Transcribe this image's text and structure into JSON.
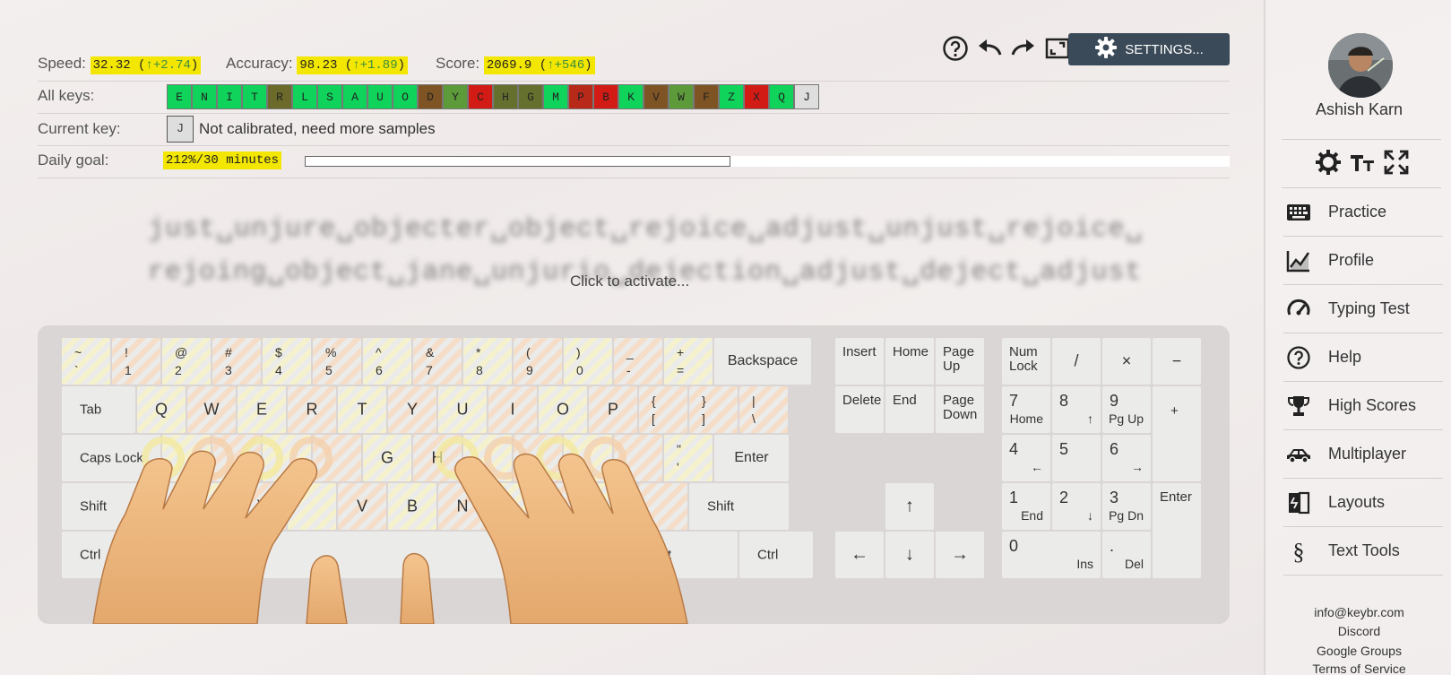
{
  "stats": {
    "speed_label": "Speed:",
    "speed_value": "32.32",
    "speed_delta": "↑+2.74",
    "accuracy_label": "Accuracy:",
    "accuracy_value": "98.23",
    "accuracy_delta": "↑+1.89",
    "score_label": "Score:",
    "score_value": "2069.9",
    "score_delta": "↑+546",
    "highlight_color": "#f3e600"
  },
  "all_keys": {
    "label": "All keys:",
    "keys": [
      {
        "k": "E",
        "color": "#0fd35a"
      },
      {
        "k": "N",
        "color": "#0fd35a"
      },
      {
        "k": "I",
        "color": "#0fd35a"
      },
      {
        "k": "T",
        "color": "#0fd35a"
      },
      {
        "k": "R",
        "color": "#6b6a2a"
      },
      {
        "k": "L",
        "color": "#0fd35a"
      },
      {
        "k": "S",
        "color": "#0fd35a"
      },
      {
        "k": "A",
        "color": "#0fd35a"
      },
      {
        "k": "U",
        "color": "#0fd35a"
      },
      {
        "k": "O",
        "color": "#0fd35a"
      },
      {
        "k": "D",
        "color": "#7f5424"
      },
      {
        "k": "Y",
        "color": "#5c9a3a"
      },
      {
        "k": "C",
        "color": "#d31b15"
      },
      {
        "k": "H",
        "color": "#66702e"
      },
      {
        "k": "G",
        "color": "#66702e"
      },
      {
        "k": "M",
        "color": "#0fd35a"
      },
      {
        "k": "P",
        "color": "#b8291a"
      },
      {
        "k": "B",
        "color": "#d31b15"
      },
      {
        "k": "K",
        "color": "#0fd35a"
      },
      {
        "k": "V",
        "color": "#7f5424"
      },
      {
        "k": "W",
        "color": "#5c9a3a"
      },
      {
        "k": "F",
        "color": "#7f5424"
      },
      {
        "k": "Z",
        "color": "#0fd35a"
      },
      {
        "k": "X",
        "color": "#d31b15"
      },
      {
        "k": "Q",
        "color": "#0fd35a"
      },
      {
        "k": "J",
        "color": "#dedede"
      }
    ]
  },
  "current_key": {
    "label": "Current key:",
    "key": "J",
    "status": "Not calibrated, need more samples"
  },
  "daily_goal": {
    "label": "Daily goal:",
    "value": "212%/30 minutes",
    "progress_fraction": 0.46
  },
  "toolbar": {
    "icons": [
      "help-icon",
      "undo-icon",
      "redo-icon",
      "fullscreen-icon"
    ],
    "settings_label": "SETTINGS..."
  },
  "practice": {
    "line1": "just␣unjure␣objecter␣object␣rejoice␣adjust␣unjust␣rejoice␣",
    "line2": "rejoing␣object␣jane␣unjurio␣dejection␣adjust␣deject␣adjust",
    "activate_hint": "Click to activate..."
  },
  "keyboard": {
    "backspace": "Backspace",
    "tab": "Tab",
    "caps": "Caps Lock",
    "enter": "Enter",
    "shift_l": "Shift",
    "shift_r": "Shift",
    "ctrl_l": "Ctrl",
    "ctrl_r": "Ctrl",
    "alt_r_partial": "t",
    "number_row": [
      {
        "top": "~",
        "bot": "`"
      },
      {
        "top": "!",
        "bot": "1"
      },
      {
        "top": "@",
        "bot": "2"
      },
      {
        "top": "#",
        "bot": "3"
      },
      {
        "top": "$",
        "bot": "4"
      },
      {
        "top": "%",
        "bot": "5"
      },
      {
        "top": "^",
        "bot": "6"
      },
      {
        "top": "&",
        "bot": "7"
      },
      {
        "top": "*",
        "bot": "8"
      },
      {
        "top": "(",
        "bot": "9"
      },
      {
        "top": ")",
        "bot": "0"
      },
      {
        "top": "_",
        "bot": "-"
      },
      {
        "top": "+",
        "bot": "="
      }
    ],
    "qwerty_row": [
      "Q",
      "W",
      "E",
      "R",
      "T",
      "Y",
      "U",
      "I",
      "O",
      "P"
    ],
    "bracket_keys": [
      {
        "top": "{",
        "bot": "["
      },
      {
        "top": "}",
        "bot": "]"
      },
      {
        "top": "|",
        "bot": "\\"
      }
    ],
    "home_row_visible": [
      "G",
      "H"
    ],
    "quote_key": {
      "top": "\"",
      "bot": "'"
    },
    "bottom_row_visible": [
      "X",
      "V",
      "B",
      "N"
    ],
    "nav_cluster": [
      [
        "Insert",
        "Home",
        "Page Up"
      ],
      [
        "Delete",
        "End",
        "Page Down"
      ]
    ],
    "arrows": {
      "up": "↑",
      "left": "←",
      "down": "↓",
      "right": "→"
    },
    "numpad": {
      "numlock": "Num Lock",
      "div": "/",
      "mul": "×",
      "minus": "−",
      "plus": "+",
      "enter": "Enter",
      "keys": [
        {
          "main": "7",
          "sub": "Home"
        },
        {
          "main": "8",
          "sub": "↑"
        },
        {
          "main": "9",
          "sub": "Pg Up"
        },
        {
          "main": "4",
          "sub": "←"
        },
        {
          "main": "5",
          "sub": ""
        },
        {
          "main": "6",
          "sub": "→"
        },
        {
          "main": "1",
          "sub": "End"
        },
        {
          "main": "2",
          "sub": "↓"
        },
        {
          "main": "3",
          "sub": "Pg Dn"
        },
        {
          "main": "0",
          "sub": "Ins"
        },
        {
          "main": ".",
          "sub": "Del"
        }
      ]
    }
  },
  "sidebar": {
    "username": "Ashish Karn",
    "top_icons": [
      "theme-gear-icon",
      "font-size-icon",
      "expand-icon"
    ],
    "nav": [
      {
        "label": "Practice",
        "icon": "keyboard-icon"
      },
      {
        "label": "Profile",
        "icon": "chart-icon"
      },
      {
        "label": "Typing Test",
        "icon": "gauge-icon"
      },
      {
        "label": "Help",
        "icon": "help-icon"
      },
      {
        "label": "High Scores",
        "icon": "trophy-icon"
      },
      {
        "label": "Multiplayer",
        "icon": "car-icon"
      },
      {
        "label": "Layouts",
        "icon": "layouts-icon"
      },
      {
        "label": "Text Tools",
        "icon": "section-icon"
      }
    ],
    "footer": [
      "info@keybr.com",
      "Discord",
      "Google Groups",
      "Terms of Service"
    ]
  }
}
